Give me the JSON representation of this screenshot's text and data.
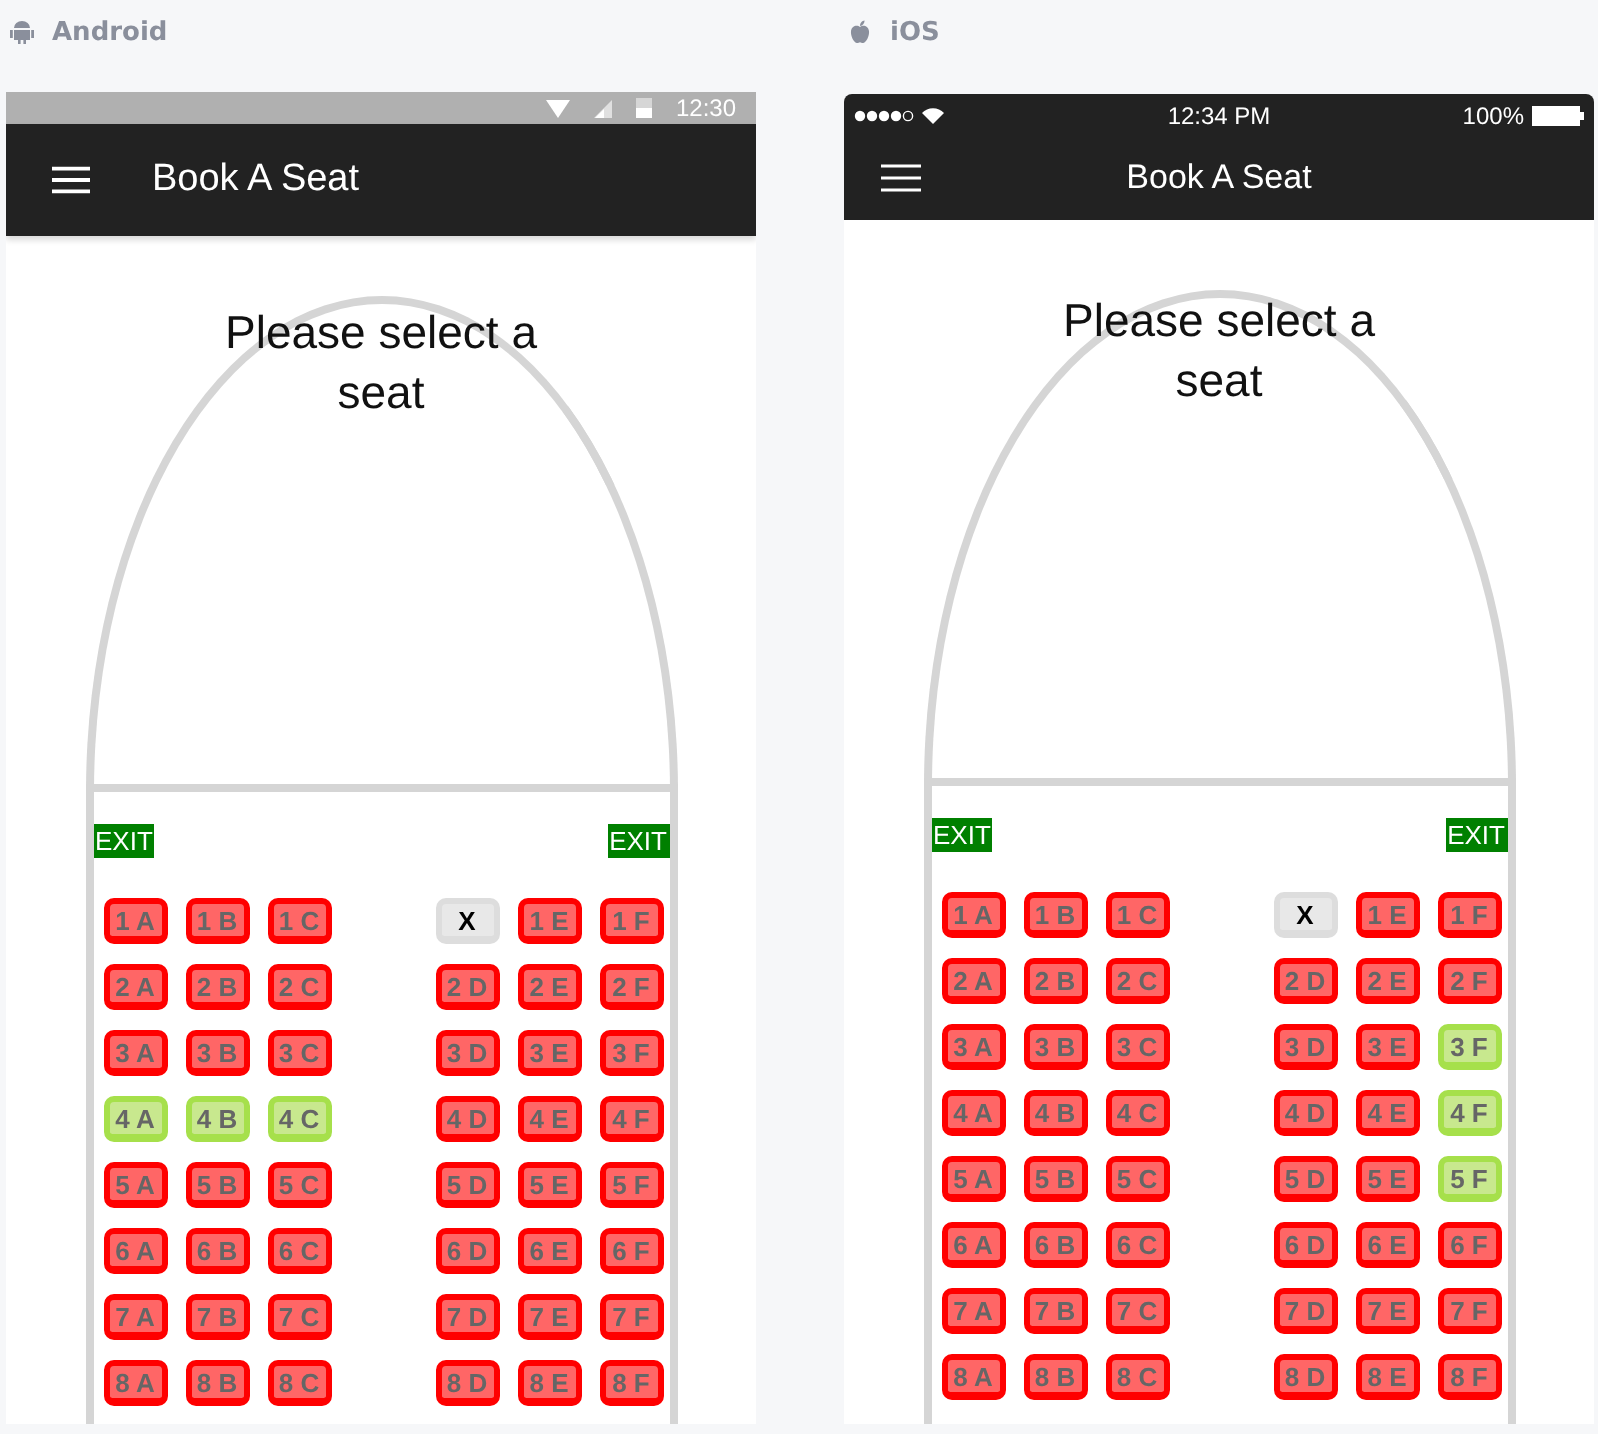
{
  "panels": [
    {
      "platform": "Android",
      "kind": "android",
      "status_bar": {
        "time": "12:30"
      },
      "app_bar": {
        "title": "Book A Seat"
      },
      "heading": "Please select a seat",
      "exits": [
        "EXIT",
        "EXIT"
      ],
      "rows": [
        {
          "seats": [
            {
              "label": "1 A",
              "kind": "taken"
            },
            {
              "label": "1 B",
              "kind": "taken"
            },
            {
              "label": "1 C",
              "kind": "taken"
            },
            {
              "label": "X",
              "kind": "blocked"
            },
            {
              "label": "1 E",
              "kind": "taken"
            },
            {
              "label": "1 F",
              "kind": "taken"
            }
          ]
        },
        {
          "seats": [
            {
              "label": "2 A",
              "kind": "taken"
            },
            {
              "label": "2 B",
              "kind": "taken"
            },
            {
              "label": "2 C",
              "kind": "taken"
            },
            {
              "label": "2 D",
              "kind": "taken"
            },
            {
              "label": "2 E",
              "kind": "taken"
            },
            {
              "label": "2 F",
              "kind": "taken"
            }
          ]
        },
        {
          "seats": [
            {
              "label": "3 A",
              "kind": "taken"
            },
            {
              "label": "3 B",
              "kind": "taken"
            },
            {
              "label": "3 C",
              "kind": "taken"
            },
            {
              "label": "3 D",
              "kind": "taken"
            },
            {
              "label": "3 E",
              "kind": "taken"
            },
            {
              "label": "3 F",
              "kind": "taken"
            }
          ]
        },
        {
          "seats": [
            {
              "label": "4 A",
              "kind": "available"
            },
            {
              "label": "4 B",
              "kind": "available"
            },
            {
              "label": "4 C",
              "kind": "available"
            },
            {
              "label": "4 D",
              "kind": "taken"
            },
            {
              "label": "4 E",
              "kind": "taken"
            },
            {
              "label": "4 F",
              "kind": "taken"
            }
          ]
        },
        {
          "seats": [
            {
              "label": "5 A",
              "kind": "taken"
            },
            {
              "label": "5 B",
              "kind": "taken"
            },
            {
              "label": "5 C",
              "kind": "taken"
            },
            {
              "label": "5 D",
              "kind": "taken"
            },
            {
              "label": "5 E",
              "kind": "taken"
            },
            {
              "label": "5 F",
              "kind": "taken"
            }
          ]
        },
        {
          "seats": [
            {
              "label": "6 A",
              "kind": "taken"
            },
            {
              "label": "6 B",
              "kind": "taken"
            },
            {
              "label": "6 C",
              "kind": "taken"
            },
            {
              "label": "6 D",
              "kind": "taken"
            },
            {
              "label": "6 E",
              "kind": "taken"
            },
            {
              "label": "6 F",
              "kind": "taken"
            }
          ]
        },
        {
          "seats": [
            {
              "label": "7 A",
              "kind": "taken"
            },
            {
              "label": "7 B",
              "kind": "taken"
            },
            {
              "label": "7 C",
              "kind": "taken"
            },
            {
              "label": "7 D",
              "kind": "taken"
            },
            {
              "label": "7 E",
              "kind": "taken"
            },
            {
              "label": "7 F",
              "kind": "taken"
            }
          ]
        },
        {
          "seats": [
            {
              "label": "8 A",
              "kind": "taken"
            },
            {
              "label": "8 B",
              "kind": "taken"
            },
            {
              "label": "8 C",
              "kind": "taken"
            },
            {
              "label": "8 D",
              "kind": "taken"
            },
            {
              "label": "8 E",
              "kind": "taken"
            },
            {
              "label": "8 F",
              "kind": "taken"
            }
          ]
        }
      ]
    },
    {
      "platform": "iOS",
      "kind": "ios",
      "status_bar": {
        "time": "12:34 PM",
        "battery": "100%"
      },
      "app_bar": {
        "title": "Book A Seat"
      },
      "heading": "Please select a seat",
      "exits": [
        "EXIT",
        "EXIT"
      ],
      "rows": [
        {
          "seats": [
            {
              "label": "1 A",
              "kind": "taken"
            },
            {
              "label": "1 B",
              "kind": "taken"
            },
            {
              "label": "1 C",
              "kind": "taken"
            },
            {
              "label": "X",
              "kind": "blocked"
            },
            {
              "label": "1 E",
              "kind": "taken"
            },
            {
              "label": "1 F",
              "kind": "taken"
            }
          ]
        },
        {
          "seats": [
            {
              "label": "2 A",
              "kind": "taken"
            },
            {
              "label": "2 B",
              "kind": "taken"
            },
            {
              "label": "2 C",
              "kind": "taken"
            },
            {
              "label": "2 D",
              "kind": "taken"
            },
            {
              "label": "2 E",
              "kind": "taken"
            },
            {
              "label": "2 F",
              "kind": "taken"
            }
          ]
        },
        {
          "seats": [
            {
              "label": "3 A",
              "kind": "taken"
            },
            {
              "label": "3 B",
              "kind": "taken"
            },
            {
              "label": "3 C",
              "kind": "taken"
            },
            {
              "label": "3 D",
              "kind": "taken"
            },
            {
              "label": "3 E",
              "kind": "taken"
            },
            {
              "label": "3 F",
              "kind": "available"
            }
          ]
        },
        {
          "seats": [
            {
              "label": "4 A",
              "kind": "taken"
            },
            {
              "label": "4 B",
              "kind": "taken"
            },
            {
              "label": "4 C",
              "kind": "taken"
            },
            {
              "label": "4 D",
              "kind": "taken"
            },
            {
              "label": "4 E",
              "kind": "taken"
            },
            {
              "label": "4 F",
              "kind": "available"
            }
          ]
        },
        {
          "seats": [
            {
              "label": "5 A",
              "kind": "taken"
            },
            {
              "label": "5 B",
              "kind": "taken"
            },
            {
              "label": "5 C",
              "kind": "taken"
            },
            {
              "label": "5 D",
              "kind": "taken"
            },
            {
              "label": "5 E",
              "kind": "taken"
            },
            {
              "label": "5 F",
              "kind": "available"
            }
          ]
        },
        {
          "seats": [
            {
              "label": "6 A",
              "kind": "taken"
            },
            {
              "label": "6 B",
              "kind": "taken"
            },
            {
              "label": "6 C",
              "kind": "taken"
            },
            {
              "label": "6 D",
              "kind": "taken"
            },
            {
              "label": "6 E",
              "kind": "taken"
            },
            {
              "label": "6 F",
              "kind": "taken"
            }
          ]
        },
        {
          "seats": [
            {
              "label": "7 A",
              "kind": "taken"
            },
            {
              "label": "7 B",
              "kind": "taken"
            },
            {
              "label": "7 C",
              "kind": "taken"
            },
            {
              "label": "7 D",
              "kind": "taken"
            },
            {
              "label": "7 E",
              "kind": "taken"
            },
            {
              "label": "7 F",
              "kind": "taken"
            }
          ]
        },
        {
          "seats": [
            {
              "label": "8 A",
              "kind": "taken"
            },
            {
              "label": "8 B",
              "kind": "taken"
            },
            {
              "label": "8 C",
              "kind": "taken"
            },
            {
              "label": "8 D",
              "kind": "taken"
            },
            {
              "label": "8 E",
              "kind": "taken"
            },
            {
              "label": "8 F",
              "kind": "taken"
            }
          ]
        }
      ]
    }
  ]
}
